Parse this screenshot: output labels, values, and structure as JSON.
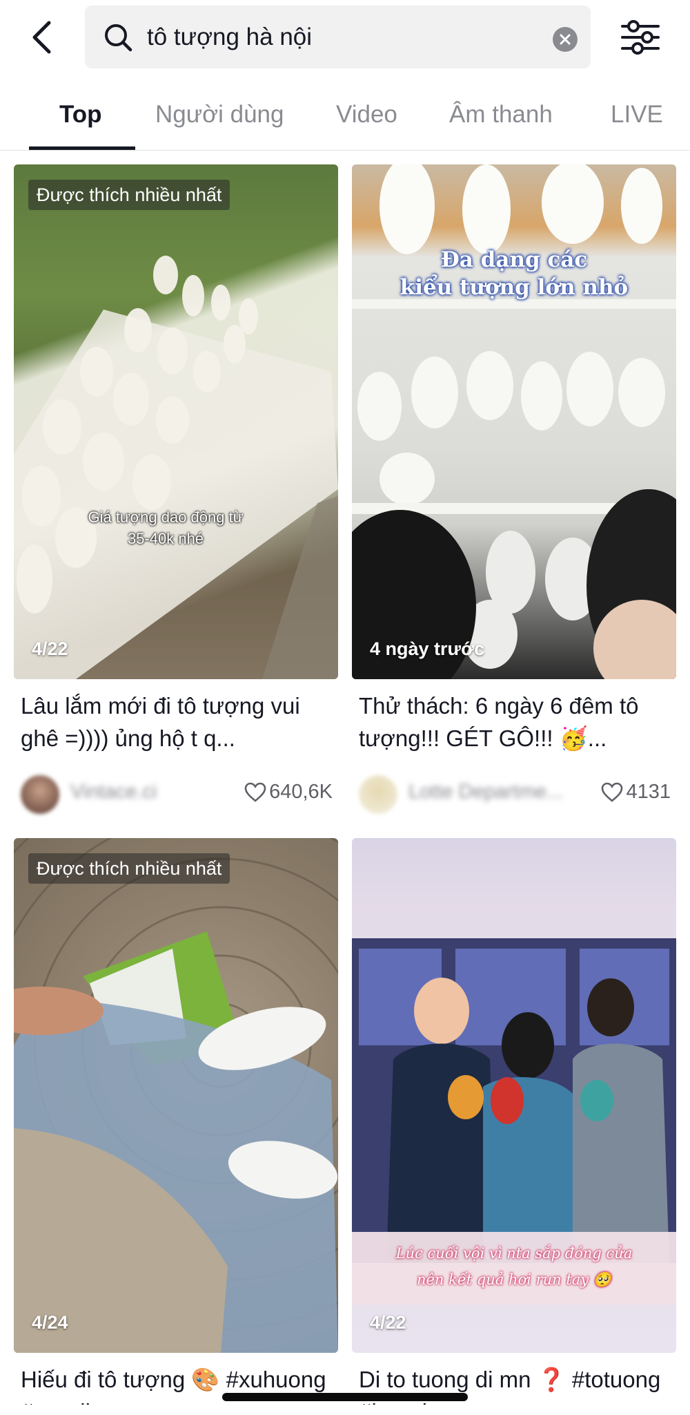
{
  "search": {
    "value": "tô tượng hà nội"
  },
  "tabs": [
    {
      "label": "Top",
      "active": true
    },
    {
      "label": "Người dùng",
      "active": false
    },
    {
      "label": "Video",
      "active": false
    },
    {
      "label": "Âm thanh",
      "active": false
    },
    {
      "label": "LIVE",
      "active": false
    }
  ],
  "results": [
    {
      "badge": "Được thích nhiều nhất",
      "meta": "4/22",
      "overlay_caption": "Giá tượng dao động từ\n35-40k nhé",
      "title": "Lâu lắm mới đi tô tượng vui ghê =)))) ủng hộ t q...",
      "author": "Vintace.ci",
      "likes": "640,6K"
    },
    {
      "badge": "",
      "meta": "4 ngày trước",
      "overlay_caption": "Đa dạng các\nkiểu tượng lớn nhỏ",
      "title": "Thử thách: 6 ngày 6 đêm tô tượng!!! GÉT GÔ!!! 🥳...",
      "author": "Lotte Departme...",
      "likes": "4131"
    },
    {
      "badge": "Được thích nhiều nhất",
      "meta": "4/24",
      "overlay_caption": "",
      "title": "Hiếu đi tô tượng 🎨 #xuhuong #trending",
      "author": "",
      "likes": ""
    },
    {
      "badge": "",
      "meta": "4/22",
      "overlay_caption": "Lúc cuối vội vì nta sắp đóng cửa\nnên kết quả hơi run tay 🥺",
      "title": "Di to tuong di mn ❓ #totuong #hanoi",
      "author": "",
      "likes": ""
    }
  ],
  "colors": {
    "text_primary": "#161823",
    "text_secondary": "#8a8b91",
    "search_bg": "#f1f1f2"
  }
}
